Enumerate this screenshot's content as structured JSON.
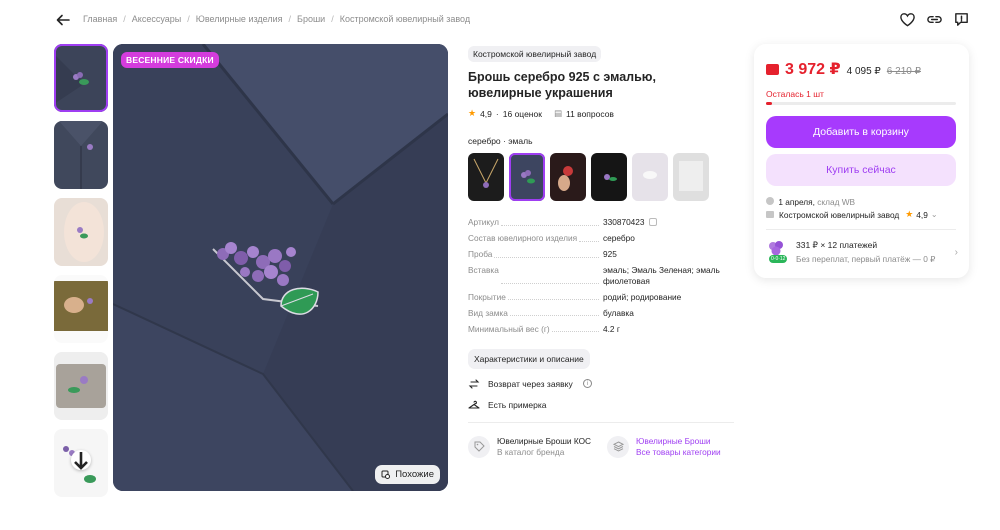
{
  "breadcrumb": {
    "items": [
      "Главная",
      "Аксессуары",
      "Ювелирные изделия",
      "Броши",
      "Костромской ювелирный завод"
    ],
    "separator": "/"
  },
  "gallery": {
    "badge": "ВЕСЕННИЕ СКИДКИ",
    "similar_label": "Похожие"
  },
  "product": {
    "brand": "Костромской ювелирный завод",
    "title": "Брошь серебро 925 с эмалью, ювелирные украшения",
    "rating": "4,9",
    "reviews": "16 оценок",
    "questions": "11 вопросов",
    "variant_label": "серебро · эмаль"
  },
  "specs": [
    {
      "key": "Артикул",
      "value": "330870423"
    },
    {
      "key": "Состав ювелирного изделия",
      "value": "серебро"
    },
    {
      "key": "Проба",
      "value": "925"
    },
    {
      "key": "Вставка",
      "value": "эмаль; Эмаль Зеленая; эмаль фиолетовая"
    },
    {
      "key": "Покрытие",
      "value": "родий; родирование"
    },
    {
      "key": "Вид замка",
      "value": "булавка"
    },
    {
      "key": "Минимальный вес (г)",
      "value": "4.2 г"
    }
  ],
  "chars_button": "Характеристики и описание",
  "perks": {
    "return": "Возврат через заявку",
    "fitting": "Есть примерка"
  },
  "links": {
    "brand_title": "Ювелирные Броши КОС",
    "brand_sub": "В каталог бренда",
    "category_title": "Ювелирные Броши",
    "category_sub": "Все товары категории"
  },
  "buy": {
    "price": "3 972 ₽",
    "price_without_wallet": "4 095 ₽",
    "price_old": "6 210 ₽",
    "stock": "Осталась 1 шт",
    "stock_fraction": 0.03,
    "cart_button": "Добавить в корзину",
    "buy_button": "Купить сейчас",
    "delivery_date": "1 апреля,",
    "delivery_place": "склад WB",
    "seller": "Костромской ювелирный завод",
    "seller_rating": "4,9",
    "installment_main": "331 ₽ × 12 платежей",
    "installment_sub": "Без переплат, первый платёж — 0 ₽",
    "installment_badge": "0·0·12"
  },
  "colors": {
    "accent": "#a73afd",
    "price_red": "#e5212d",
    "badge_pink": "#d43cdd"
  }
}
